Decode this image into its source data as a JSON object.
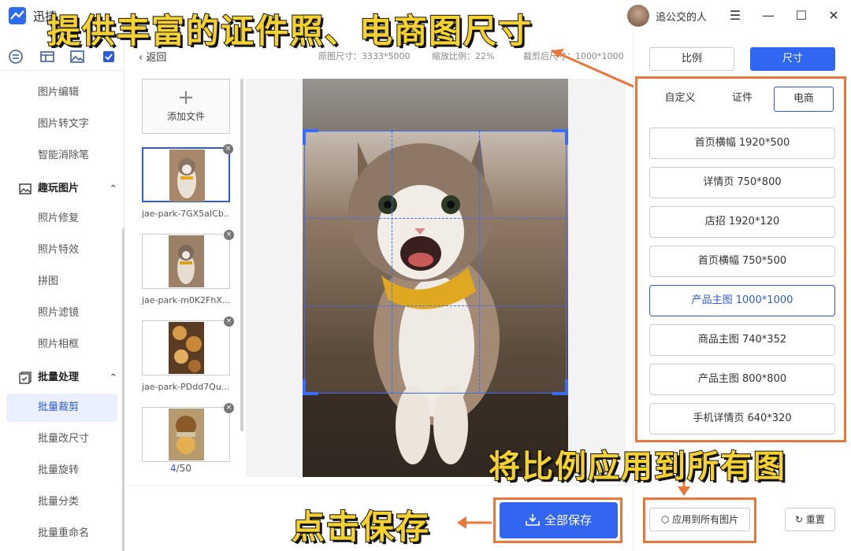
{
  "titlebar": {
    "app_name": "迅捷",
    "user_name": "追公交的人",
    "menu_glyph": "☰",
    "min_glyph": "—",
    "max_glyph": "☐",
    "close_glyph": "✕"
  },
  "sidebar": {
    "items_top": [
      {
        "label": "图片编辑"
      },
      {
        "label": "图片转文字"
      },
      {
        "label": "智能消除笔"
      }
    ],
    "group_fun": {
      "label": "趣玩图片",
      "caret": "^"
    },
    "items_fun": [
      {
        "label": "照片修复"
      },
      {
        "label": "照片特效"
      },
      {
        "label": "拼图"
      },
      {
        "label": "照片滤镜"
      },
      {
        "label": "照片相框"
      }
    ],
    "group_batch": {
      "label": "批量处理",
      "caret": "^"
    },
    "items_batch": [
      {
        "label": "批量裁剪"
      },
      {
        "label": "批量改尺寸"
      },
      {
        "label": "批量旋转"
      },
      {
        "label": "批量分类"
      },
      {
        "label": "批量重命名"
      }
    ]
  },
  "workspace": {
    "back_label": "返回",
    "original_size": "原图尺寸：3333*5000",
    "zoom": "缩放比例：22%",
    "crop_size": "裁剪后尺寸：1000*1000",
    "add_file_label": "添加文件",
    "add_plus": "+",
    "thumbs": [
      {
        "caption": "jae-park-7GX5aICb..."
      },
      {
        "caption": "jae-park-m0K2FhX..."
      },
      {
        "caption": "jae-park-PDdd7Qu..."
      },
      {
        "caption": ""
      }
    ],
    "close_glyph": "×",
    "page_current": "4",
    "page_total": "/50",
    "save_all_label": "全部保存"
  },
  "right_panel": {
    "tab_ratio": "比例",
    "tab_size": "尺寸",
    "subtabs": [
      "自定义",
      "证件",
      "电商"
    ],
    "presets": [
      "首页横幅 1920*500",
      "详情页 750*800",
      "店招 1920*120",
      "首页横幅 750*500",
      "产品主图 1000*1000",
      "商品主图 740*352",
      "产品主图 800*800",
      "手机详情页 640*320"
    ],
    "apply_all_label": "应用到所有图片",
    "reset_label": "重置"
  },
  "annotations": {
    "top": "提供丰富的证件照、电商图尺寸",
    "right": "将比例应用到所有图",
    "bottom": "点击保存",
    "color": "#e8773b",
    "text_color": "#f5d22e"
  },
  "colors": {
    "accent": "#2f66f2",
    "active_bg": "#eaf0ff",
    "orange": "#e8773b"
  }
}
